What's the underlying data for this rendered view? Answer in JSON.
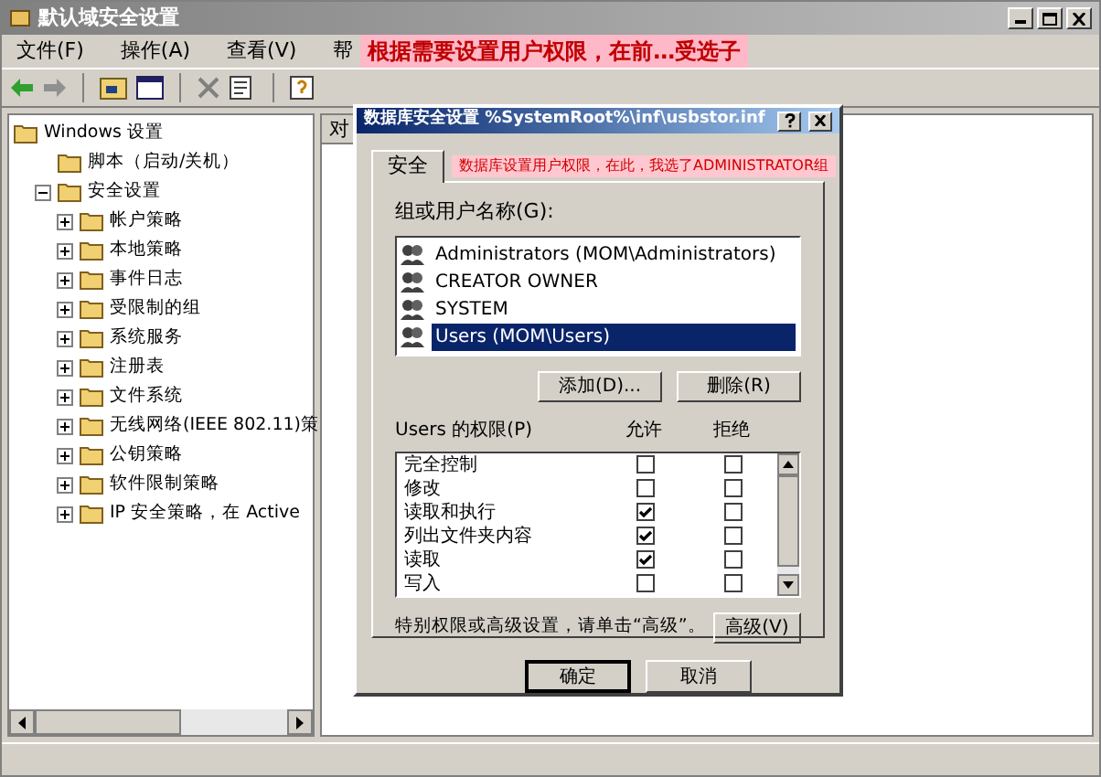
{
  "window": {
    "title": "默认域安全设置"
  },
  "menu": [
    "文件(F)",
    "操作(A)",
    "查看(V)",
    "帮"
  ],
  "top_annotation": "根据需要设置用户权限，在前…受选子",
  "tree": [
    {
      "label": "Windows 设置",
      "children": [
        {
          "label": "脚本（启动/关机）"
        },
        {
          "label": "安全设置",
          "expanded": true,
          "children": [
            {
              "label": "帐户策略",
              "expanded": false
            },
            {
              "label": "本地策略",
              "expanded": false
            },
            {
              "label": "事件日志",
              "expanded": false
            },
            {
              "label": "受限制的组",
              "expanded": false
            },
            {
              "label": "系统服务",
              "expanded": false
            },
            {
              "label": "注册表",
              "expanded": false
            },
            {
              "label": "文件系统",
              "expanded": false
            },
            {
              "label": "无线网络(IEEE 802.11)策",
              "expanded": false
            },
            {
              "label": "公钥策略",
              "expanded": false
            },
            {
              "label": "软件限制策略",
              "expanded": false
            },
            {
              "label": "IP 安全策略，在 Active",
              "expanded": false
            }
          ]
        }
      ]
    }
  ],
  "right_pane": {
    "column_1": "对"
  },
  "dialog": {
    "title": "数据库安全设置 %SystemRoot%\\inf\\usbstor.inf",
    "tabs": [
      {
        "label": "安全",
        "selected": true
      }
    ],
    "annotation": "数据库设置用户权限，在此，我选了ADMINISTRATOR组",
    "group_label": "组或用户名称(G):",
    "users": [
      {
        "name": "Administrators (MOM\\Administrators)",
        "selected": false
      },
      {
        "name": "CREATOR OWNER",
        "selected": false
      },
      {
        "name": "SYSTEM",
        "selected": false
      },
      {
        "name": "Users (MOM\\Users)",
        "selected": true
      }
    ],
    "add_button": "添加(D)...",
    "remove_button": "删除(R)",
    "permissions_label": "Users 的权限(P)",
    "allow_header": "允许",
    "deny_header": "拒绝",
    "permissions": [
      {
        "name": "完全控制",
        "allow": false,
        "deny": false
      },
      {
        "name": "修改",
        "allow": false,
        "deny": false
      },
      {
        "name": "读取和执行",
        "allow": true,
        "deny": false
      },
      {
        "name": "列出文件夹内容",
        "allow": true,
        "deny": false
      },
      {
        "name": "读取",
        "allow": true,
        "deny": false
      },
      {
        "name": "写入",
        "allow": false,
        "deny": false
      }
    ],
    "advanced_hint": "特别权限或高级设置，请单击“高级”。",
    "advanced_button": "高级(V)",
    "buttons": [
      "确定",
      "取消"
    ]
  }
}
